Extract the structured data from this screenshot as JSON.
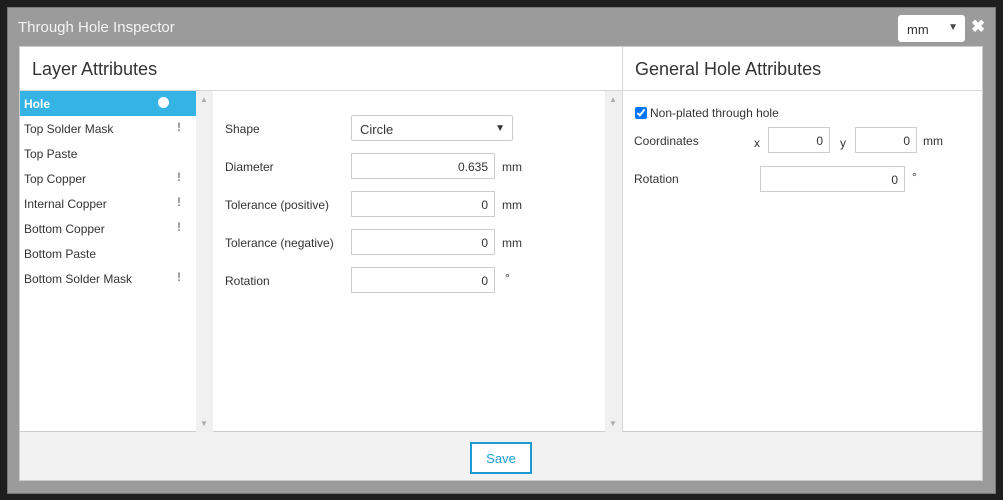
{
  "dialog": {
    "title": "Through Hole Inspector",
    "unit": "mm",
    "close_icon": "close-icon"
  },
  "layer": {
    "header": "Layer Attributes",
    "items": [
      {
        "label": "Hole",
        "marker": "dot",
        "selected": true
      },
      {
        "label": "Top Solder Mask",
        "marker": "!"
      },
      {
        "label": "Top Paste",
        "marker": ""
      },
      {
        "label": "Top Copper",
        "marker": "!"
      },
      {
        "label": "Internal Copper",
        "marker": "!"
      },
      {
        "label": "Bottom Copper",
        "marker": "!"
      },
      {
        "label": "Bottom Paste",
        "marker": ""
      },
      {
        "label": "Bottom Solder Mask",
        "marker": "!"
      }
    ],
    "form": {
      "shape_label": "Shape",
      "shape_value": "Circle",
      "diameter_label": "Diameter",
      "diameter_value": "0.635",
      "diameter_unit": "mm",
      "tol_pos_label": "Tolerance (positive)",
      "tol_pos_value": "0",
      "tol_pos_unit": "mm",
      "tol_neg_label": "Tolerance (negative)",
      "tol_neg_value": "0",
      "tol_neg_unit": "mm",
      "rotation_label": "Rotation",
      "rotation_value": "0",
      "rotation_unit": "°"
    }
  },
  "general": {
    "header": "General Hole Attributes",
    "npth_label": "Non-plated through hole",
    "npth_checked": true,
    "coords_label": "Coordinates",
    "x_label": "x",
    "x_value": "0",
    "y_label": "y",
    "y_value": "0",
    "coords_unit": "mm",
    "rotation_label": "Rotation",
    "rotation_value": "0",
    "rotation_unit": "°"
  },
  "footer": {
    "save_label": "Save"
  },
  "colors": {
    "accent": "#35b3e4"
  }
}
